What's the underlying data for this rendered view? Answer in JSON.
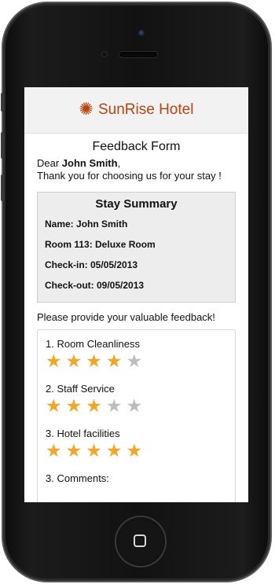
{
  "header": {
    "brand": "SunRise Hotel",
    "logo_icon": "sun-icon",
    "brand_color": "#b94410"
  },
  "form": {
    "title": "Feedback Form",
    "greeting_prefix": "Dear ",
    "guest_name": "John Smith",
    "greeting_suffix": ",",
    "thanks": "Thank you for choosing us for your stay !"
  },
  "summary": {
    "title": "Stay Summary",
    "name": "Name: John Smith",
    "room": "Room 113: Deluxe Room",
    "checkin": "Check-in: 05/05/2013",
    "checkout": "Check-out: 09/05/2013"
  },
  "feedback": {
    "prompt": "Please provide your valuable feedback!",
    "questions": [
      {
        "label": "1. Room Cleanliness",
        "rating": 4,
        "max": 5
      },
      {
        "label": "2. Staff Service",
        "rating": 3,
        "max": 5
      },
      {
        "label": "3. Hotel facilities",
        "rating": 5,
        "max": 5
      }
    ],
    "comments_label": "3. Comments:"
  },
  "colors": {
    "star_on": "#f5a623",
    "star_off": "#bdbdbd"
  }
}
